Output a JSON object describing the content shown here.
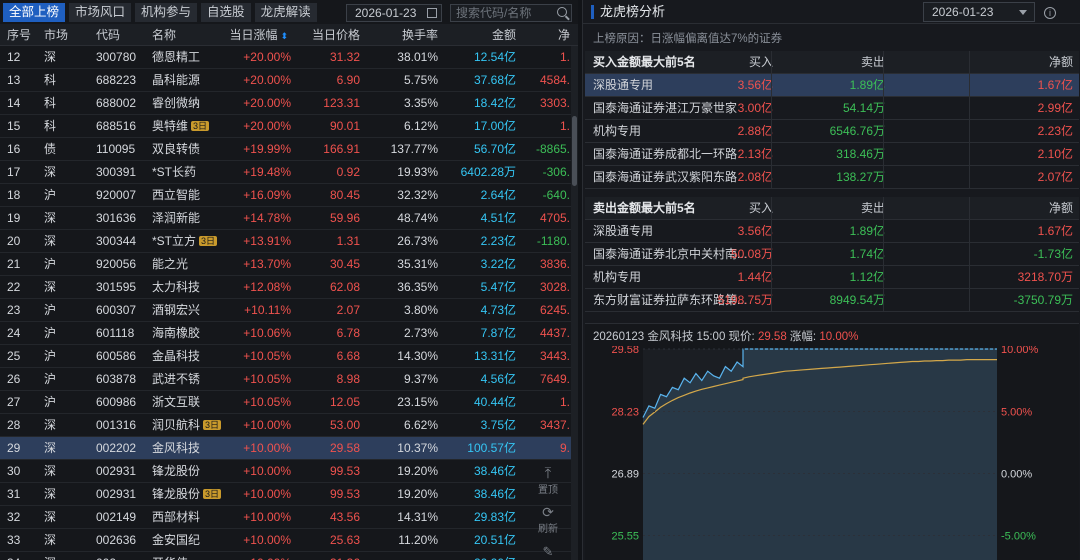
{
  "tabs": [
    "全部上榜",
    "市场风口",
    "机构参与",
    "自选股",
    "龙虎解读"
  ],
  "date": "2026-01-23",
  "search_placeholder": "搜索代码/名称",
  "table": {
    "headers": [
      "序号",
      "市场",
      "代码",
      "名称",
      "当日涨幅",
      "当日价格",
      "换手率",
      "金额",
      "净"
    ],
    "sort_icon": "sort-icon",
    "rows": [
      {
        "no": "12",
        "mk": "深",
        "code": "300780",
        "name": "德恩精工",
        "pct": "+20.00%",
        "price": "31.32",
        "turn": "38.01%",
        "amt": "12.54亿",
        "net": "1.",
        "neg": false
      },
      {
        "no": "13",
        "mk": "科",
        "code": "688223",
        "name": "晶科能源",
        "pct": "+20.00%",
        "price": "6.90",
        "turn": "5.75%",
        "amt": "37.68亿",
        "net": "4584.",
        "neg": false
      },
      {
        "no": "14",
        "mk": "科",
        "code": "688002",
        "name": "睿创微纳",
        "pct": "+20.00%",
        "price": "123.31",
        "turn": "3.35%",
        "amt": "18.42亿",
        "net": "3303.",
        "neg": false
      },
      {
        "no": "15",
        "mk": "科",
        "code": "688516",
        "name": "奥特维",
        "badge": "3日",
        "pct": "+20.00%",
        "price": "90.01",
        "turn": "6.12%",
        "amt": "17.00亿",
        "net": "1.",
        "neg": false
      },
      {
        "no": "16",
        "mk": "债",
        "code": "110095",
        "name": "双良转债",
        "pct": "+19.99%",
        "price": "166.91",
        "turn": "137.77%",
        "amt": "56.70亿",
        "net": "-8865.",
        "neg": true
      },
      {
        "no": "17",
        "mk": "深",
        "code": "300391",
        "name": "*ST长药",
        "pct": "+19.48%",
        "price": "0.92",
        "turn": "19.93%",
        "amt": "6402.28万",
        "net": "-306.",
        "neg": true
      },
      {
        "no": "18",
        "mk": "沪",
        "code": "920007",
        "name": "西立智能",
        "pct": "+16.09%",
        "price": "80.45",
        "turn": "32.32%",
        "amt": "2.64亿",
        "net": "-640.",
        "neg": true
      },
      {
        "no": "19",
        "mk": "深",
        "code": "301636",
        "name": "泽润新能",
        "pct": "+14.78%",
        "price": "59.96",
        "turn": "48.74%",
        "amt": "4.51亿",
        "net": "4705.",
        "neg": false
      },
      {
        "no": "20",
        "mk": "深",
        "code": "300344",
        "name": "*ST立方",
        "badge": "3日",
        "pct": "+13.91%",
        "price": "1.31",
        "turn": "26.73%",
        "amt": "2.23亿",
        "net": "-1180.",
        "neg": true
      },
      {
        "no": "21",
        "mk": "沪",
        "code": "920056",
        "name": "能之光",
        "pct": "+13.70%",
        "price": "30.45",
        "turn": "35.31%",
        "amt": "3.22亿",
        "net": "3836.",
        "neg": false
      },
      {
        "no": "22",
        "mk": "深",
        "code": "301595",
        "name": "太力科技",
        "pct": "+12.08%",
        "price": "62.08",
        "turn": "36.35%",
        "amt": "5.47亿",
        "net": "3028.",
        "neg": false
      },
      {
        "no": "23",
        "mk": "沪",
        "code": "600307",
        "name": "酒钢宏兴",
        "pct": "+10.11%",
        "price": "2.07",
        "turn": "3.80%",
        "amt": "4.73亿",
        "net": "6245.",
        "neg": false
      },
      {
        "no": "24",
        "mk": "沪",
        "code": "601118",
        "name": "海南橡胶",
        "pct": "+10.06%",
        "price": "6.78",
        "turn": "2.73%",
        "amt": "7.87亿",
        "net": "4437.",
        "neg": false
      },
      {
        "no": "25",
        "mk": "沪",
        "code": "600586",
        "name": "金晶科技",
        "pct": "+10.05%",
        "price": "6.68",
        "turn": "14.30%",
        "amt": "13.31亿",
        "net": "3443.",
        "neg": false
      },
      {
        "no": "26",
        "mk": "沪",
        "code": "603878",
        "name": "武进不锈",
        "pct": "+10.05%",
        "price": "8.98",
        "turn": "9.37%",
        "amt": "4.56亿",
        "net": "7649.",
        "neg": false
      },
      {
        "no": "27",
        "mk": "沪",
        "code": "600986",
        "name": "浙文互联",
        "pct": "+10.05%",
        "price": "12.05",
        "turn": "23.15%",
        "amt": "40.44亿",
        "net": "1.",
        "neg": false
      },
      {
        "no": "28",
        "mk": "深",
        "code": "001316",
        "name": "润贝航科",
        "badge": "3日",
        "pct": "+10.00%",
        "price": "53.00",
        "turn": "6.62%",
        "amt": "3.75亿",
        "net": "3437.",
        "neg": false
      },
      {
        "no": "29",
        "mk": "深",
        "code": "002202",
        "name": "金风科技",
        "pct": "+10.00%",
        "price": "29.58",
        "turn": "10.37%",
        "amt": "100.57亿",
        "net": "9.",
        "neg": false,
        "sel": true
      },
      {
        "no": "30",
        "mk": "深",
        "code": "002931",
        "name": "锋龙股份",
        "pct": "+10.00%",
        "price": "99.53",
        "turn": "19.20%",
        "amt": "38.46亿",
        "net": "",
        "neg": false
      },
      {
        "no": "31",
        "mk": "深",
        "code": "002931",
        "name": "锋龙股份",
        "badge": "3日",
        "pct": "+10.00%",
        "price": "99.53",
        "turn": "19.20%",
        "amt": "38.46亿",
        "net": "",
        "neg": false
      },
      {
        "no": "32",
        "mk": "深",
        "code": "002149",
        "name": "西部材料",
        "pct": "+10.00%",
        "price": "43.56",
        "turn": "14.31%",
        "amt": "29.83亿",
        "net": "",
        "neg": false
      },
      {
        "no": "33",
        "mk": "深",
        "code": "002636",
        "name": "金安国纪",
        "pct": "+10.00%",
        "price": "25.63",
        "turn": "11.20%",
        "amt": "20.51亿",
        "net": "",
        "neg": false
      },
      {
        "no": "34",
        "mk": "深",
        "code": "002",
        "name": "开华伟",
        "pct": "+10.00%",
        "price": "31.36",
        "turn": "",
        "amt": "20.20亿",
        "net": "",
        "neg": false
      }
    ]
  },
  "float": {
    "top_label": "置顶",
    "refresh_label": "刷新"
  },
  "right": {
    "title": "龙虎榜分析",
    "date": "2026-01-23",
    "info_icon": "i",
    "reason": "上榜原因：日涨幅偏离值达7%的证券",
    "buy_top": {
      "headers": [
        "买入金额最大前5名",
        "买入",
        "卖出",
        "净额"
      ],
      "rows": [
        {
          "name": "深股通专用",
          "buy": "3.56亿",
          "sell": "1.89亿",
          "net": "1.67亿",
          "net_neg": false,
          "sel": true
        },
        {
          "name": "国泰海通证券湛江万豪世家",
          "buy": "3.00亿",
          "sell": "54.14万",
          "net": "2.99亿",
          "net_neg": false
        },
        {
          "name": "机构专用",
          "buy": "2.88亿",
          "sell": "6546.76万",
          "net": "2.23亿",
          "net_neg": false
        },
        {
          "name": "国泰海通证券成都北一环路",
          "buy": "2.13亿",
          "sell": "318.46万",
          "net": "2.10亿",
          "net_neg": false
        },
        {
          "name": "国泰海通证券武汉紫阳东路",
          "buy": "2.08亿",
          "sell": "138.27万",
          "net": "2.07亿",
          "net_neg": false
        }
      ]
    },
    "sell_top": {
      "headers": [
        "卖出金额最大前5名",
        "买入",
        "卖出",
        "净额"
      ],
      "rows": [
        {
          "name": "深股通专用",
          "buy": "3.56亿",
          "sell": "1.89亿",
          "net": "1.67亿",
          "net_neg": false
        },
        {
          "name": "国泰海通证券北京中关村南...",
          "buy": "50.08万",
          "sell": "1.74亿",
          "net": "-1.73亿",
          "net_neg": true
        },
        {
          "name": "机构专用",
          "buy": "1.44亿",
          "sell": "1.12亿",
          "net": "3218.70万",
          "net_neg": false
        },
        {
          "name": "东方财富证券拉萨东环路第...",
          "buy": "5198.75万",
          "sell": "8949.54万",
          "net": "-3750.79万",
          "net_neg": true
        }
      ]
    },
    "chart_head": {
      "prefix": "20260123 金风科技 15:00 现价:",
      "price": "29.58",
      "pct_label": "涨幅:",
      "pct": "10.00%"
    }
  },
  "chart_data": {
    "type": "line",
    "title": "20260123 金风科技 15:00 现价: 29.58 涨幅: 10.00%",
    "y_left_ticks": [
      "29.58",
      "28.23",
      "26.89",
      "25.55"
    ],
    "y_right_ticks": [
      "10.00%",
      "5.00%",
      "0.00%",
      "-5.00%"
    ],
    "ylim": [
      25.0,
      29.58
    ],
    "prev_close": 26.89,
    "price_color": "#5ab4ee",
    "avg_color": "#d4a84a",
    "price_series": [
      28.1,
      28.35,
      28.3,
      28.6,
      28.55,
      28.75,
      28.7,
      28.95,
      28.85,
      29.05,
      28.9,
      29.1,
      29.0,
      28.95,
      29.2,
      29.1,
      29.3,
      29.2,
      29.58,
      29.58,
      29.58,
      29.58,
      29.58,
      29.58,
      29.58,
      29.58,
      29.58,
      29.58,
      29.58,
      29.58,
      29.58,
      29.58,
      29.58,
      29.58,
      29.58,
      29.58,
      29.58,
      29.58,
      29.58,
      29.58,
      29.58,
      29.58,
      29.58,
      29.58,
      29.58,
      29.58,
      29.58,
      29.58,
      29.58,
      29.58,
      29.58,
      29.58,
      29.58,
      29.58,
      29.58,
      29.58,
      29.58,
      29.58,
      29.58,
      29.58,
      29.58
    ],
    "avg_series": [
      27.95,
      28.12,
      28.22,
      28.32,
      28.4,
      28.47,
      28.53,
      28.58,
      28.63,
      28.67,
      28.71,
      28.74,
      28.77,
      28.8,
      28.83,
      28.86,
      28.89,
      28.92,
      28.95,
      28.98,
      29.0,
      29.02,
      29.04,
      29.06,
      29.08,
      29.1,
      29.11,
      29.12,
      29.13,
      29.14,
      29.15,
      29.16,
      29.17,
      29.18,
      29.19,
      29.2,
      29.21,
      29.22,
      29.23,
      29.24,
      29.25,
      29.26,
      29.27,
      29.28,
      29.29,
      29.3,
      29.31,
      29.31,
      29.32,
      29.32,
      29.33,
      29.33,
      29.34,
      29.34,
      29.34,
      29.35,
      29.35,
      29.35,
      29.35,
      29.35,
      29.35
    ]
  }
}
